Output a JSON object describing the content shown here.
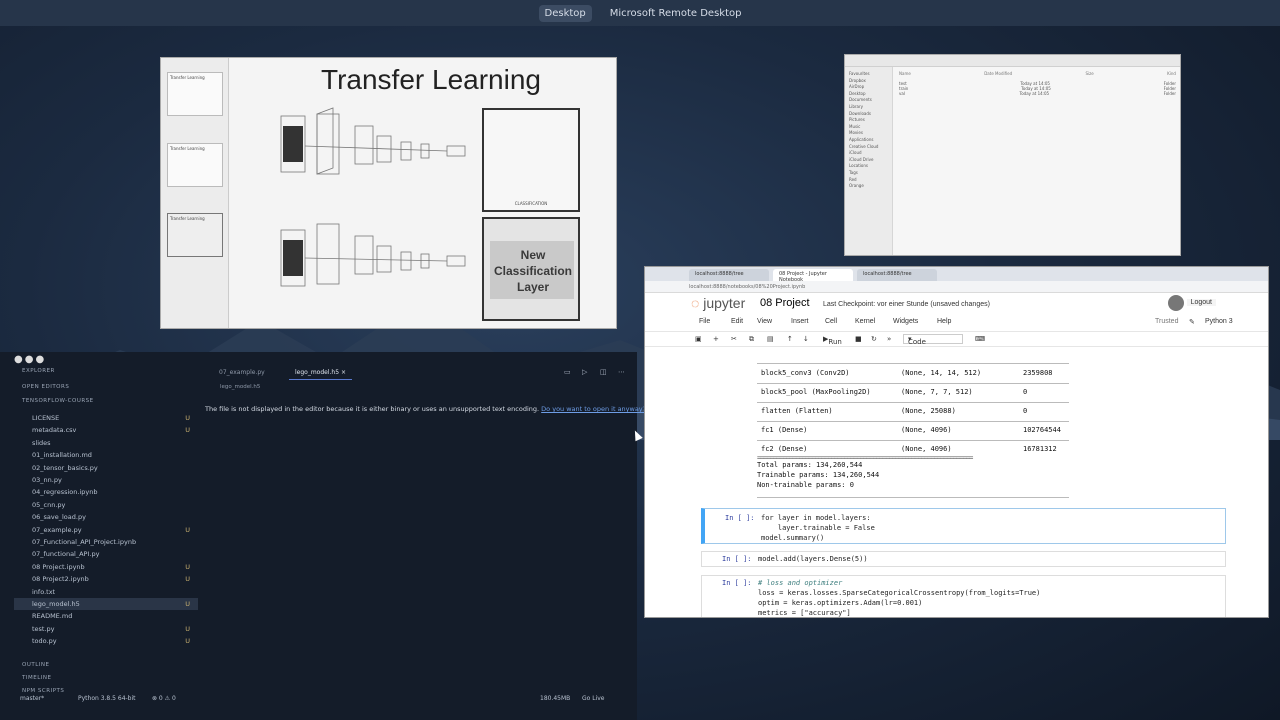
{
  "topbar": {
    "desktop_tab": "Desktop",
    "app_title": "Microsoft Remote Desktop"
  },
  "slide": {
    "title": "Transfer Learning",
    "new_layer_line1": "New",
    "new_layer_line2": "Classification",
    "new_layer_line3": "Layer",
    "classification_caption": "CLASSIFICATION",
    "thumb1_title": "Transfer Learning",
    "thumb2_title": "Transfer Learning",
    "thumb3_title": "Transfer Learning"
  },
  "finder": {
    "window_title": "",
    "col_name": "Name",
    "col_modified": "Date Modified",
    "col_size": "Size",
    "col_kind": "Kind",
    "sidebar": [
      "Favourites",
      "Dropbox",
      "AirDrop",
      "Desktop",
      "Documents",
      "Library",
      "Downloads",
      "Pictures",
      "Music",
      "Movies",
      "Applications",
      "Creative Cloud",
      "iCloud",
      "iCloud Drive",
      "Locations",
      "Tags",
      "Red",
      "Orange"
    ],
    "rows": [
      {
        "name": "test",
        "modified": "Today at 14:05",
        "kind": "Folder"
      },
      {
        "name": "train",
        "modified": "Today at 14:05",
        "kind": "Folder"
      },
      {
        "name": "val",
        "modified": "Today at 14:05",
        "kind": "Folder"
      }
    ]
  },
  "vscode": {
    "explorer_label": "EXPLORER",
    "open_editors_label": "OPEN EDITORS",
    "project_label": "TENSORFLOW-COURSE",
    "files": [
      {
        "name": "LICENSE",
        "status": "U"
      },
      {
        "name": "metadata.csv",
        "status": "U"
      },
      {
        "name": "slides",
        "status": ""
      },
      {
        "name": "01_installation.md",
        "status": ""
      },
      {
        "name": "02_tensor_basics.py",
        "status": ""
      },
      {
        "name": "03_nn.py",
        "status": ""
      },
      {
        "name": "04_regression.ipynb",
        "status": ""
      },
      {
        "name": "05_cnn.py",
        "status": ""
      },
      {
        "name": "06_save_load.py",
        "status": ""
      },
      {
        "name": "07_example.py",
        "status": "U"
      },
      {
        "name": "07_Functional_API_Project.ipynb",
        "status": ""
      },
      {
        "name": "07_functional_API.py",
        "status": ""
      },
      {
        "name": "08 Project.ipynb",
        "status": "U"
      },
      {
        "name": "08 Project2.ipynb",
        "status": "U"
      },
      {
        "name": "info.txt",
        "status": ""
      },
      {
        "name": "lego_model.h5",
        "status": "U"
      },
      {
        "name": "README.md",
        "status": ""
      },
      {
        "name": "test.py",
        "status": "U"
      },
      {
        "name": "todo.py",
        "status": "U"
      }
    ],
    "outline_label": "OUTLINE",
    "timeline_label": "TIMELINE",
    "npm_label": "NPM SCRIPTS",
    "tab1": "07_example.py",
    "tab2": "lego_model.h5",
    "breadcrumb": "lego_model.h5",
    "message": "The file is not displayed in the editor because it is either binary or uses an unsupported text encoding.",
    "message_link": "Do you want to open it anyway?",
    "status_branch": "master*",
    "status_python": "Python 3.8.5 64-bit",
    "status_problems": "⊗ 0 ⚠ 0",
    "status_size": "180.45MB",
    "status_golive": "Go Live"
  },
  "jupyter": {
    "tab1": "localhost:8888/tree",
    "tab2": "08 Project - Jupyter Notebook",
    "tab3": "localhost:8888/tree",
    "address": "localhost:8888/notebooks/08%20Project.ipynb",
    "logo": "jupyter",
    "notebook_name": "08 Project",
    "checkpoint": "Last Checkpoint: vor einer Stunde  (unsaved changes)",
    "logout": "Logout",
    "menu": [
      "File",
      "Edit",
      "View",
      "Insert",
      "Cell",
      "Kernel",
      "Widgets",
      "Help"
    ],
    "trusted": "Trusted",
    "kernel": "Python 3",
    "run_label": "Run",
    "cell_type": "Code",
    "summary_rows": [
      {
        "layer": "block5_conv3 (Conv2D)",
        "shape": "(None, 14, 14, 512)",
        "params": "2359808"
      },
      {
        "layer": "block5_pool (MaxPooling2D)",
        "shape": "(None, 7, 7, 512)",
        "params": "0"
      },
      {
        "layer": "flatten (Flatten)",
        "shape": "(None, 25088)",
        "params": "0"
      },
      {
        "layer": "fc1 (Dense)",
        "shape": "(None, 4096)",
        "params": "102764544"
      },
      {
        "layer": "fc2 (Dense)",
        "shape": "(None, 4096)",
        "params": "16781312"
      }
    ],
    "total_params": "Total params: 134,260,544",
    "trainable_params": "Trainable params: 134,260,544",
    "non_trainable_params": "Non-trainable params: 0",
    "cell1_prompt": "In [ ]:",
    "cell1_line1": "for layer in model.layers:",
    "cell1_line2": "    layer.trainable = False",
    "cell1_line3": "model.summary()",
    "cell2_prompt": "In [ ]:",
    "cell2_line1": "model.add(layers.Dense(5))",
    "cell3_prompt": "In [ ]:",
    "cell3_line1": "# loss and optimizer",
    "cell3_line2": "loss = keras.losses.SparseCategoricalCrossentropy(from_logits=True)",
    "cell3_line3": "optim = keras.optimizers.Adam(lr=0.001)",
    "cell3_line4": "metrics = [\"accuracy\"]"
  }
}
